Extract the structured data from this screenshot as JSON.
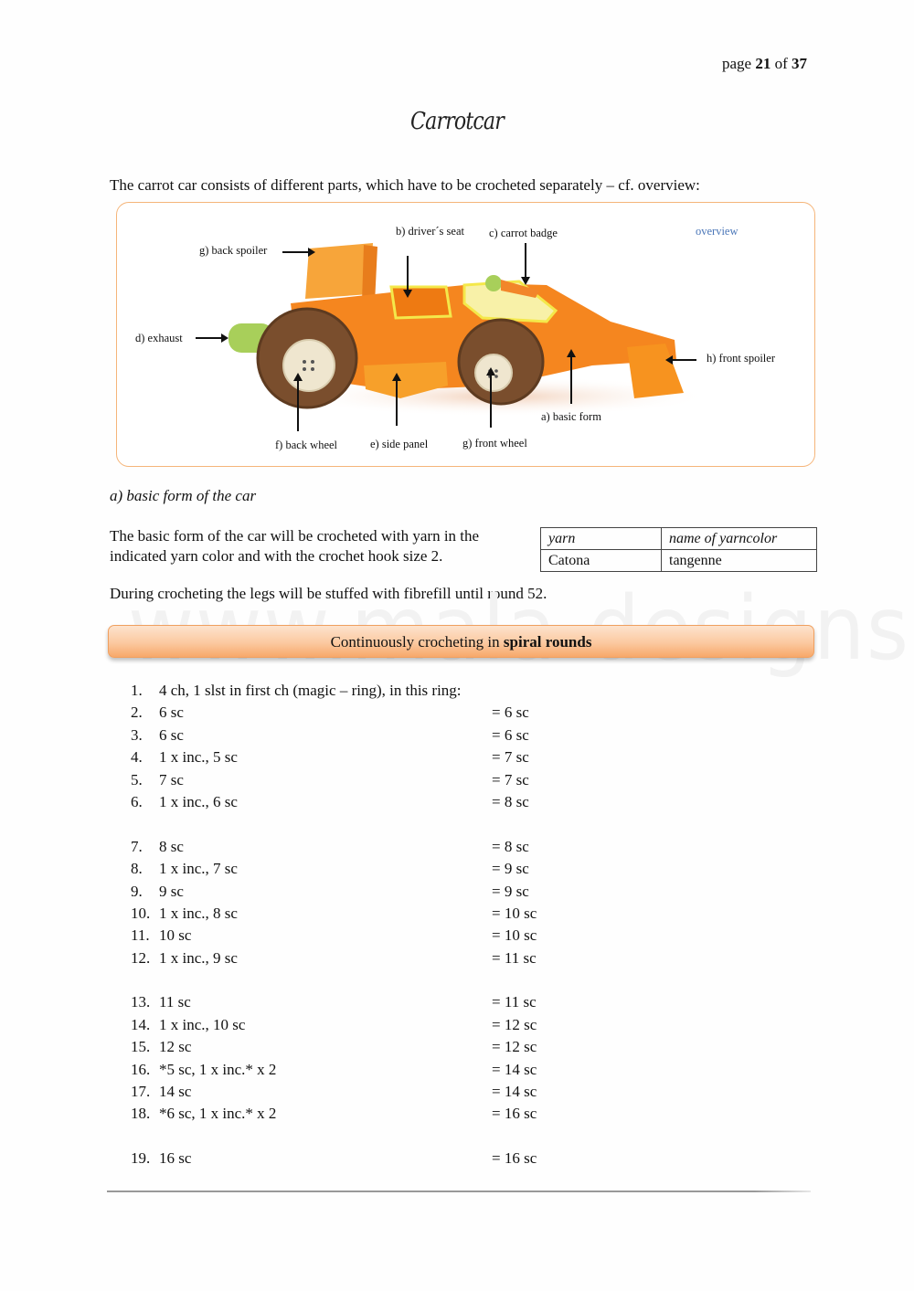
{
  "page": {
    "label": "page",
    "current": "21",
    "of": "of",
    "total": "37"
  },
  "title": "Carrotcar",
  "intro": "The carrot car consists of different parts, which have to be crocheted separately – cf. overview:",
  "overview": {
    "link": "overview",
    "labels": {
      "drivers_seat": "b) driver´s seat",
      "carrot_badge": "c) carrot badge",
      "back_spoiler": "g) back spoiler",
      "exhaust": "d) exhaust",
      "front_spoiler": "h) front spoiler",
      "basic_form": "a)  basic form",
      "back_wheel": "f)  back wheel",
      "side_panel": "e) side panel",
      "front_wheel": "g) front wheel"
    },
    "colors": {
      "body": "#f5861f",
      "spoiler": "#f7a53a",
      "wheel": "#7a4e2d",
      "button": "#efe6cf",
      "exhaust": "#a8cf5a",
      "trim": "#f4e84a",
      "border": "#f5b57a"
    }
  },
  "section": {
    "heading": "a) basic form of the car",
    "para1": "The basic form of the car will be crocheted with yarn in the indicated yarn color and with the crochet hook size 2.",
    "para2": "During crocheting the legs will be stuffed with fibrefill until round 52."
  },
  "yarn_table": {
    "headers": [
      "yarn",
      "name of yarncolor"
    ],
    "rows": [
      [
        "Catona",
        "tangenne"
      ]
    ]
  },
  "watermark": "www.mala-designs.de",
  "banner": {
    "text": "Continuously crocheting in ",
    "bold": "spiral rounds"
  },
  "rounds": [
    {
      "num": "1.",
      "instr": "4 ch, 1 slst in first ch (magic – ring), in this ring:",
      "total": ""
    },
    {
      "num": "2.",
      "instr": "6 sc",
      "total": "= 6 sc"
    },
    {
      "num": "3.",
      "instr": "6 sc",
      "total": "= 6 sc"
    },
    {
      "num": "4.",
      "instr": "1 x inc., 5 sc",
      "total": "= 7 sc"
    },
    {
      "num": "5.",
      "instr": "7 sc",
      "total": "= 7 sc"
    },
    {
      "num": "6.",
      "instr": "1 x inc., 6 sc",
      "total": "= 8 sc"
    },
    {
      "num": "7.",
      "instr": "8 sc",
      "total": "= 8 sc"
    },
    {
      "num": "8.",
      "instr": "1 x inc., 7 sc",
      "total": "= 9 sc"
    },
    {
      "num": "9.",
      "instr": "9 sc",
      "total": "= 9 sc"
    },
    {
      "num": "10.",
      "instr": "1 x inc., 8 sc",
      "total": "= 10 sc"
    },
    {
      "num": "11.",
      "instr": "10 sc",
      "total": "= 10 sc"
    },
    {
      "num": "12.",
      "instr": "1 x inc., 9 sc",
      "total": "= 11 sc"
    },
    {
      "num": "13.",
      "instr": "11 sc",
      "total": "= 11 sc"
    },
    {
      "num": "14.",
      "instr": "1 x inc., 10 sc",
      "total": "= 12 sc"
    },
    {
      "num": "15.",
      "instr": "12 sc",
      "total": "= 12 sc"
    },
    {
      "num": "16.",
      "instr": "*5 sc, 1 x inc.* x 2",
      "total": "= 14 sc"
    },
    {
      "num": "17.",
      "instr": "14 sc",
      "total": "= 14 sc"
    },
    {
      "num": "18.",
      "instr": "*6 sc, 1 x inc.* x 2",
      "total": "= 16 sc"
    },
    {
      "num": "19.",
      "instr": "16 sc",
      "total": "= 16 sc"
    }
  ]
}
